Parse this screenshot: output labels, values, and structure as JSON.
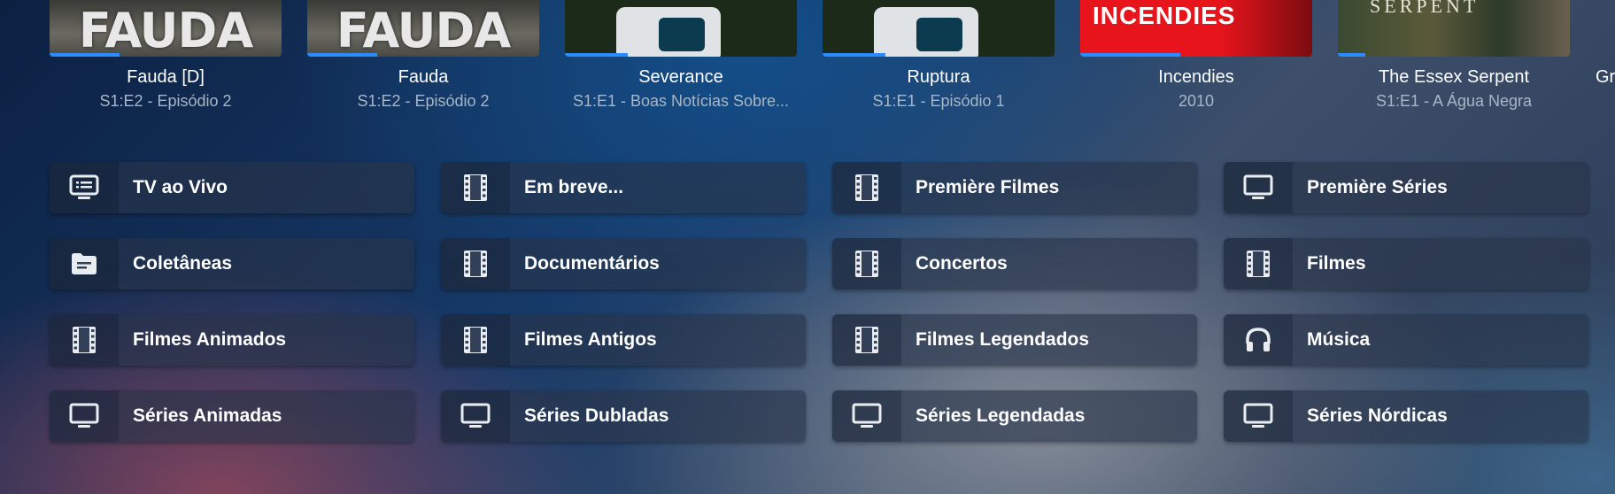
{
  "continue_watching": [
    {
      "title": "Fauda [D]",
      "subtitle": "S1:E2 - Episódio 2",
      "thumb_text": "FAUDA",
      "progress": 0.3
    },
    {
      "title": "Fauda",
      "subtitle": "S1:E2 - Episódio 2",
      "thumb_text": "FAUDA",
      "progress": 0.3
    },
    {
      "title": "Severance",
      "subtitle": "S1:E1 - Boas Notícias Sobre...",
      "thumb_text": "",
      "progress": 0.27
    },
    {
      "title": "Ruptura",
      "subtitle": "S1:E1 - Episódio 1",
      "thumb_text": "",
      "progress": 0.27
    },
    {
      "title": "Incendies",
      "subtitle": "2010",
      "thumb_text": "INCENDIES",
      "progress": 0.43
    },
    {
      "title": "The Essex Serpent",
      "subtitle": "S1:E1 - A Água Negra",
      "thumb_text": "SERPENT",
      "progress": 0.12
    },
    {
      "title": "Gr",
      "subtitle": "",
      "thumb_text": "",
      "progress": 0
    }
  ],
  "libraries": [
    {
      "label": "TV ao Vivo",
      "icon": "live-tv-guide-icon"
    },
    {
      "label": "Em breve...",
      "icon": "film-icon"
    },
    {
      "label": "Première Filmes",
      "icon": "film-icon"
    },
    {
      "label": "Première Séries",
      "icon": "tv-icon"
    },
    {
      "label": "Coletâneas",
      "icon": "folder-icon"
    },
    {
      "label": "Documentários",
      "icon": "film-icon"
    },
    {
      "label": "Concertos",
      "icon": "film-icon"
    },
    {
      "label": "Filmes",
      "icon": "film-icon"
    },
    {
      "label": "Filmes Animados",
      "icon": "film-icon"
    },
    {
      "label": "Filmes Antigos",
      "icon": "film-icon"
    },
    {
      "label": "Filmes Legendados",
      "icon": "film-icon"
    },
    {
      "label": "Música",
      "icon": "headphones-icon"
    },
    {
      "label": "Séries Animadas",
      "icon": "tv-icon"
    },
    {
      "label": "Séries Dubladas",
      "icon": "tv-icon"
    },
    {
      "label": "Séries Legendadas",
      "icon": "tv-icon"
    },
    {
      "label": "Séries Nórdicas",
      "icon": "tv-icon"
    }
  ],
  "colors": {
    "progress": "#2a8cff",
    "incendies_bg": "#e8141c",
    "severance_bg": "#1c2a1a"
  }
}
